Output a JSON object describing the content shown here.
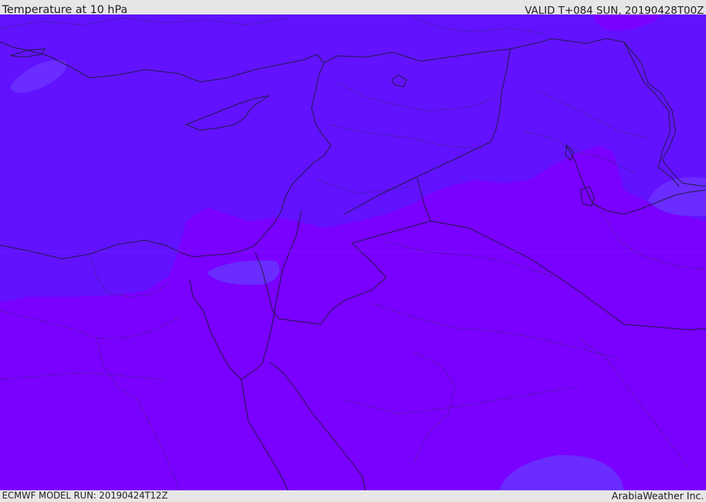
{
  "header": {
    "title": "Temperature at 10 hPa",
    "valid_time": "VALID T+084 SUN, 20190428T00Z"
  },
  "footer": {
    "model_run": "ECMWF MODEL RUN: 20190424T12Z",
    "credit": "ArabiaWeather Inc."
  },
  "map": {
    "field_colors": {
      "north_band": "#6212ff",
      "south_band": "#7a00ff",
      "light_patch": "#6a2cff"
    },
    "border_color": "#1a1a3a"
  }
}
